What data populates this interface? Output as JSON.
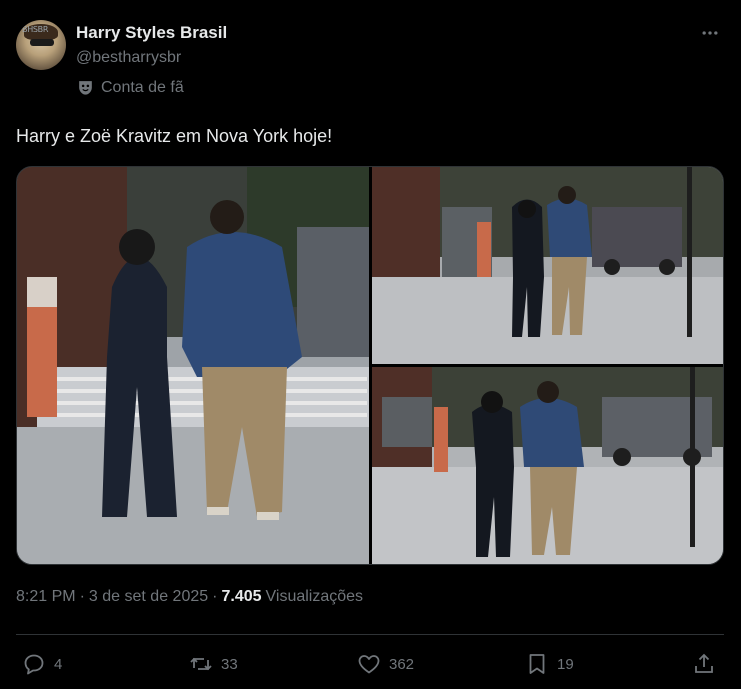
{
  "author": {
    "display_name": "Harry Styles Brasil",
    "handle": "@bestharrysbr",
    "badge_label": "Conta de fã",
    "avatar_mark": "BHSBR"
  },
  "post": {
    "text": "Harry e Zoë Kravitz em Nova York hoje!",
    "time": "8:21 PM",
    "separator": "·",
    "date": "3 de set de 2025",
    "views_count": "7.405",
    "views_label": "Visualizações"
  },
  "media": [
    {
      "name": "photo-1",
      "icon": "photo"
    },
    {
      "name": "photo-2",
      "icon": "photo"
    },
    {
      "name": "photo-3",
      "icon": "photo"
    }
  ],
  "actions": {
    "replies": "4",
    "reposts": "33",
    "likes": "362",
    "bookmarks": "19"
  },
  "colors": {
    "background": "#000000",
    "text_primary": "#e7e9ea",
    "text_secondary": "#71767b",
    "border": "#2f3336"
  }
}
